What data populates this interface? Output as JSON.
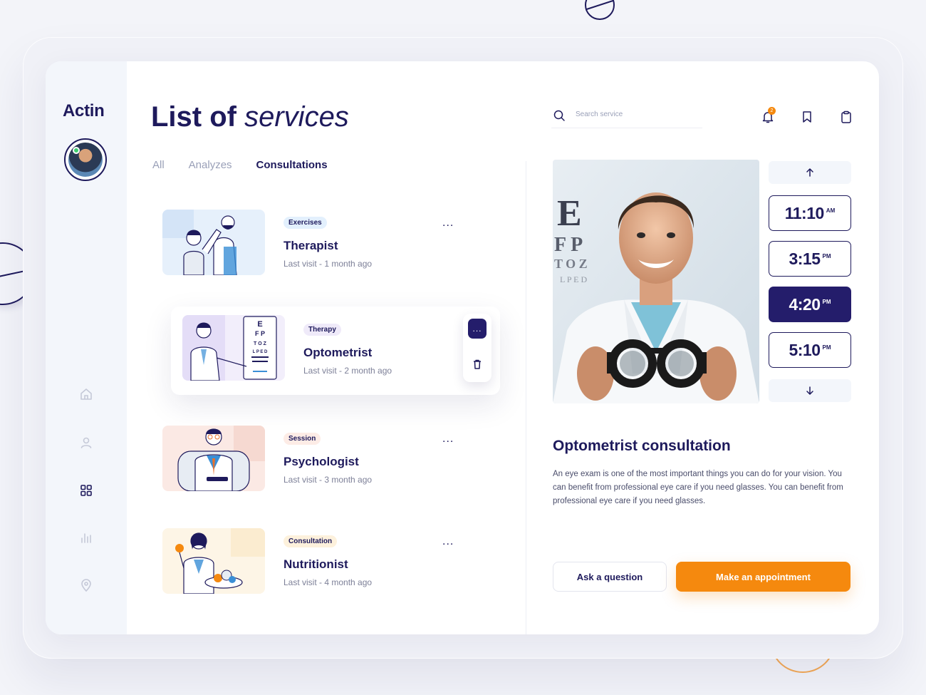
{
  "app": {
    "logo": "Actin"
  },
  "header": {
    "title_bold": "List of",
    "title_italic": "services"
  },
  "tabs": [
    {
      "label": "All",
      "active": false
    },
    {
      "label": "Analyzes",
      "active": false
    },
    {
      "label": "Consultations",
      "active": true
    }
  ],
  "search": {
    "placeholder": "Search service",
    "value": ""
  },
  "notifications": {
    "count": "2"
  },
  "sidebar": {
    "nav": [
      {
        "icon": "home-icon"
      },
      {
        "icon": "user-icon"
      },
      {
        "icon": "grid-icon",
        "active": true
      },
      {
        "icon": "chart-icon"
      },
      {
        "icon": "location-icon"
      }
    ]
  },
  "services": [
    {
      "tag": "Exercises",
      "name": "Therapist",
      "visit": "Last visit - 1 month ago",
      "more": "..."
    },
    {
      "tag": "Therapy",
      "name": "Optometrist",
      "visit": "Last visit - 2 month ago",
      "more": "...",
      "selected": true
    },
    {
      "tag": "Session",
      "name": "Psychologist",
      "visit": "Last visit - 3 month ago",
      "more": "..."
    },
    {
      "tag": "Consultation",
      "name": "Nutritionist",
      "visit": "Last visit - 4 month ago",
      "more": "..."
    }
  ],
  "times": [
    {
      "time": "11:10",
      "suffix": "AM"
    },
    {
      "time": "3:15",
      "suffix": "PM"
    },
    {
      "time": "4:20",
      "suffix": "PM",
      "selected": true
    },
    {
      "time": "5:10",
      "suffix": "PM"
    }
  ],
  "detail": {
    "title": "Optometrist consultation",
    "description": "An eye exam is one of the most important things you can do for your vision. You can benefit from professional eye care if you need glasses. You can benefit from professional eye care if you need glasses."
  },
  "actions": {
    "ask": "Ask a question",
    "appointment": "Make an appointment"
  },
  "colors": {
    "navy": "#1e1a5c",
    "accent": "#f5890e",
    "selected_slot": "#241d6b"
  }
}
